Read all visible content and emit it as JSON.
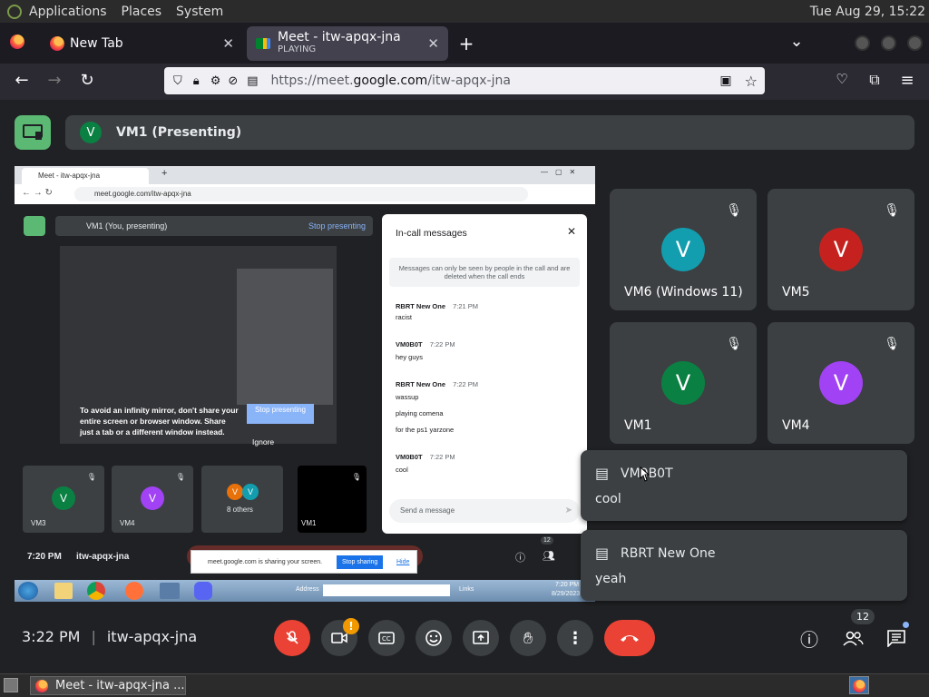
{
  "system": {
    "menus": [
      "Applications",
      "Places",
      "System"
    ],
    "clock": "Tue Aug 29, 15:22"
  },
  "browser": {
    "tabs": [
      {
        "title": "New Tab",
        "subtitle": ""
      },
      {
        "title": "Meet - itw-apqx-jna",
        "subtitle": "PLAYING"
      }
    ],
    "url": {
      "prefix": "https://meet.",
      "domain": "google.com",
      "path": "/itw-apqx-jna"
    }
  },
  "presenter": {
    "avatar_letter": "V",
    "label": "VM1 (Presenting)"
  },
  "tiles": [
    {
      "name": "VM6 (Windows 11)",
      "letter": "V",
      "color": "#129eaf"
    },
    {
      "name": "VM5",
      "letter": "V",
      "color": "#c5221f"
    },
    {
      "name": "VM1",
      "letter": "V",
      "color": "#0b8043"
    },
    {
      "name": "VM4",
      "letter": "V",
      "color": "#a142f4"
    }
  ],
  "notifications": [
    {
      "sender": "VM0B0T",
      "message": "cool"
    },
    {
      "sender": "RBRT New One",
      "message": "yeah"
    }
  ],
  "footer": {
    "time": "3:22 PM",
    "meeting_code": "itw-apqx-jna",
    "participants_badge": "12",
    "camera_alert": "!"
  },
  "shared_screen": {
    "tab_title": "Meet - itw-apqx-jna",
    "url": "meet.google.com/itw-apqx-jna",
    "presenting_label": "VM1 (You, presenting)",
    "stop_presenting": "Stop presenting",
    "warning": "To avoid an infinity mirror, don't share your entire screen or browser window. Share just a tab or a different window instead.",
    "stop_btn": "Stop presenting",
    "ignore": "Ignore",
    "chat": {
      "title": "In-call messages",
      "notice": "Messages can only be seen by people in the call and are deleted when the call ends",
      "messages": [
        {
          "sender": "RBRT New One",
          "time": "7:21 PM",
          "lines": [
            "racist"
          ]
        },
        {
          "sender": "VM0B0T",
          "time": "7:22 PM",
          "lines": [
            "hey guys"
          ]
        },
        {
          "sender": "RBRT New One",
          "time": "7:22 PM",
          "lines": [
            "wassup",
            "playing comena",
            "for the ps1 yarzone"
          ]
        },
        {
          "sender": "VM0B0T",
          "time": "7:22 PM",
          "lines": [
            "cool"
          ]
        }
      ],
      "placeholder": "Send a message"
    },
    "mini_tiles": [
      {
        "name": "VM3",
        "letter": "V",
        "color": "#0b8043"
      },
      {
        "name": "VM4",
        "letter": "V",
        "color": "#a142f4"
      },
      {
        "name": "8 others",
        "letter": "V",
        "color": "#e8710a"
      },
      {
        "name": "VM1",
        "letter": "",
        "color": "#000000"
      }
    ],
    "footer_time": "7:20 PM",
    "footer_code": "itw-apqx-jna",
    "participants_badge": "12",
    "sharing_notice": "meet.google.com is sharing your screen.",
    "stop_sharing": "Stop sharing",
    "hide": "Hide",
    "taskbar_address": "Address",
    "taskbar_links": "Links",
    "taskbar_time": "7:20 PM",
    "taskbar_date": "8/29/2023"
  },
  "taskbar": {
    "window_title": "Meet - itw-apqx-jna ..."
  }
}
